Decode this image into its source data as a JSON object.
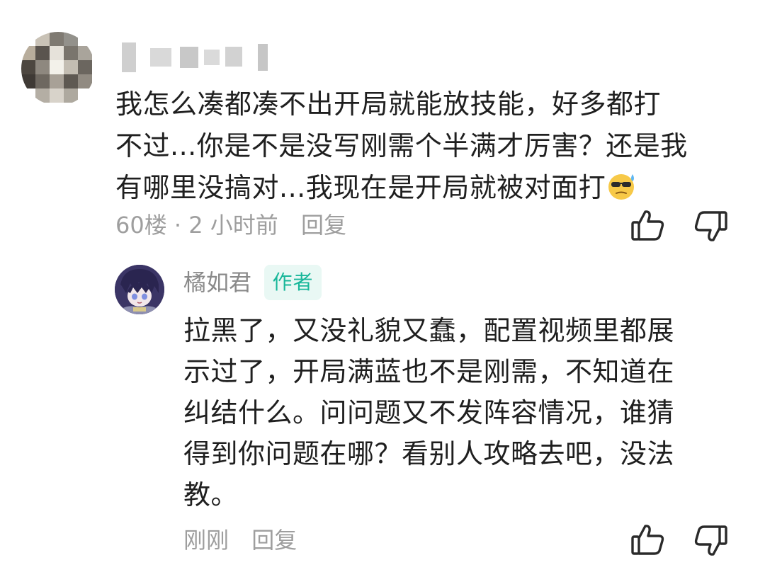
{
  "comment": {
    "text_lines": [
      "我怎么凑都凑不出开局就能放技能，好多都打",
      "不过...你是不是没写刚需个半满才厉害？还是我",
      "有哪里没搞对...我现在是开局就被对面打"
    ],
    "emoji": "sweat-sunglasses-emoji",
    "floor": "60楼",
    "separator": " · ",
    "time": "2 小时前",
    "reply_label": "回复"
  },
  "reply": {
    "author_name": "橘如君",
    "author_badge": "作者",
    "text_lines": [
      "拉黑了，又没礼貌又蠢，配置视频里都展",
      "示过了，开局满蓝也不是刚需，不知道在",
      "纠结什么。问问题又不发阵容情况，谁猜",
      "得到你问题在哪？看别人攻略去吧，没法",
      "教。"
    ],
    "time": "刚刚",
    "reply_label": "回复"
  },
  "icons": {
    "like": "thumbs-up-icon",
    "dislike": "thumbs-down-icon"
  },
  "colors": {
    "text": "#1f1f1f",
    "meta": "#9e9e9e",
    "badge_text": "#19b79a",
    "badge_bg": "#e9f8f4"
  }
}
